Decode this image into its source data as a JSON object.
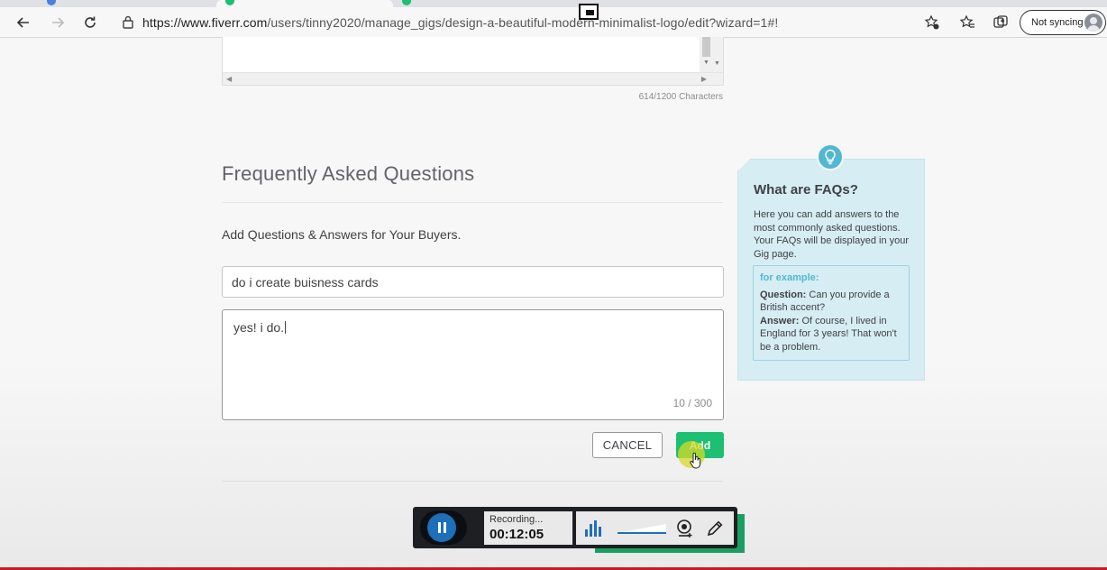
{
  "browser": {
    "url_host": "https://www.fiverr.com",
    "url_path": "/users/tinny2020/manage_gigs/design-a-beautiful-modern-minimalist-logo/edit?wizard=1#!",
    "sync_label": "Not syncing"
  },
  "description": {
    "char_count": "614/1200 Characters"
  },
  "faq": {
    "title": "Frequently Asked Questions",
    "subtitle": "Add Questions & Answers for Your Buyers.",
    "question_value": "do i create buisness cards",
    "answer_value": "yes! i do.",
    "answer_count": "10 / 300",
    "cancel_label": "CANCEL",
    "add_label": "Add"
  },
  "tip": {
    "title": "What are FAQs?",
    "body": "Here you can add answers to the most commonly asked questions. Your FAQs will be displayed in your Gig page.",
    "example_label": "for example:",
    "question_label": "Question:",
    "question_text": " Can you provide a British accent?",
    "answer_label": "Answer:",
    "answer_text": " Of course, I lived in England for 3 years! That won't be a problem."
  },
  "recorder": {
    "status": "Recording...",
    "time": "00:12:05"
  },
  "colors": {
    "accent_green": "#1dbf73",
    "tip_background": "#d6edf3",
    "tip_accent": "#52b7d1",
    "recorder_blue": "#1d6fb8"
  },
  "icons": [
    "back-arrow-icon",
    "forward-arrow-icon",
    "reload-icon",
    "lock-icon",
    "add-favorite-icon",
    "favorites-icon",
    "collections-icon",
    "lightbulb-icon",
    "pause-icon",
    "audio-level-icon",
    "webcam-icon",
    "pen-icon",
    "hand-cursor-icon"
  ]
}
